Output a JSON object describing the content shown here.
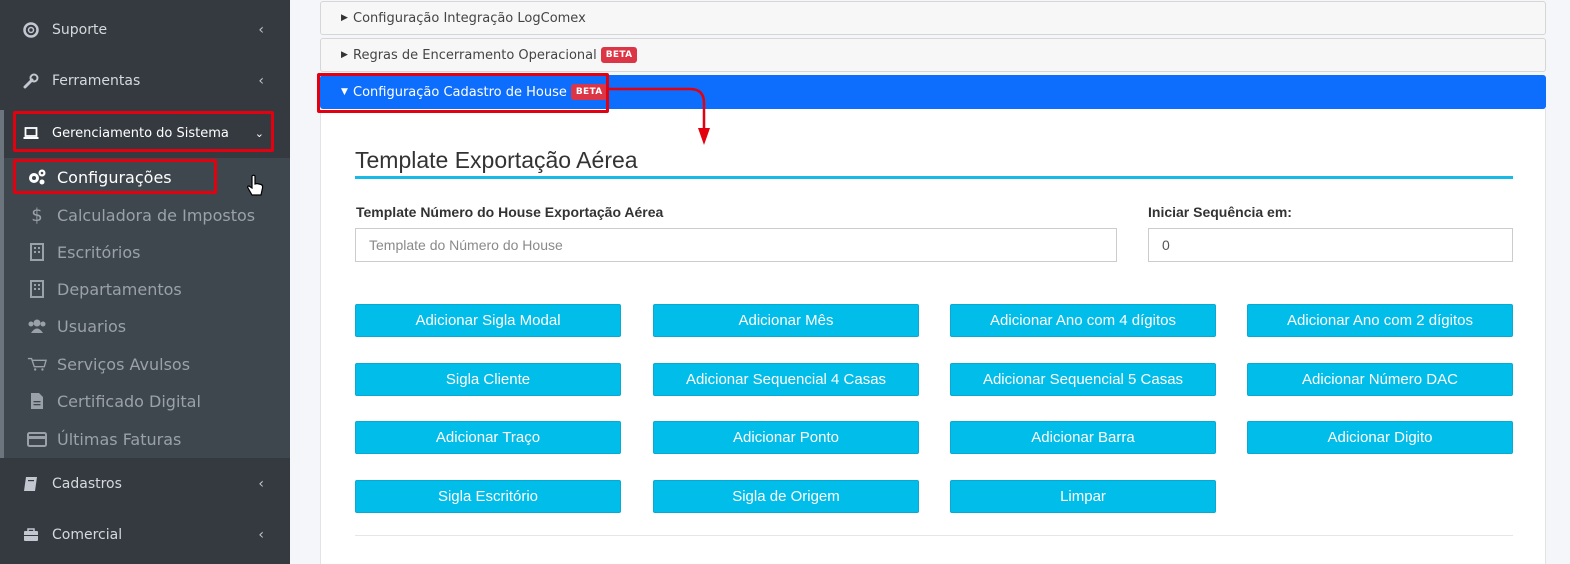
{
  "sidebar": {
    "top_items": [
      {
        "label": "Suporte",
        "icon": "life-ring-icon"
      },
      {
        "label": "Ferramentas",
        "icon": "wrench-icon"
      }
    ],
    "system_item": {
      "label": "Gerenciamento do Sistema",
      "icon": "laptop-icon"
    },
    "sub_items": [
      {
        "label": "Configurações",
        "icon": "cogs-icon"
      },
      {
        "label": "Calculadora de Impostos",
        "icon": "dollar-icon"
      },
      {
        "label": "Escritórios",
        "icon": "building-icon"
      },
      {
        "label": "Departamentos",
        "icon": "building-icon"
      },
      {
        "label": "Usuarios",
        "icon": "users-icon"
      },
      {
        "label": "Serviços Avulsos",
        "icon": "cart-icon"
      },
      {
        "label": "Certificado Digital",
        "icon": "file-icon"
      },
      {
        "label": "Últimas Faturas",
        "icon": "credit-card-icon"
      }
    ],
    "bottom_items": [
      {
        "label": "Cadastros",
        "icon": "book-icon"
      },
      {
        "label": "Comercial",
        "icon": "briefcase-icon"
      }
    ]
  },
  "accordion": [
    {
      "label": "Configuração Integração LogComex",
      "badge": ""
    },
    {
      "label": "Regras de Encerramento Operacional",
      "badge": "BETA"
    },
    {
      "label": "Configuração Cadastro de House",
      "badge": "BETA"
    }
  ],
  "form": {
    "section_title": "Template Exportação Aérea",
    "template_label": "Template Número do House Exportação Aérea",
    "template_placeholder": "Template do Número do House",
    "template_value": "",
    "sequence_label": "Iniciar Sequência em:",
    "sequence_value": "0"
  },
  "buttons": [
    "Adicionar Sigla Modal",
    "Adicionar Mês",
    "Adicionar Ano com 4 dígitos",
    "Adicionar Ano com 2 dígitos",
    "Sigla Cliente",
    "Adicionar Sequencial 4 Casas",
    "Adicionar Sequencial 5 Casas",
    "Adicionar Número DAC",
    "Adicionar Traço",
    "Adicionar Ponto",
    "Adicionar Barra",
    "Adicionar Digito",
    "Sigla Escritório",
    "Sigla de Origem",
    "Limpar"
  ],
  "colors": {
    "sidebar_bg": "#343a40",
    "accordion_active": "#0d6efd",
    "button_bg": "#00bde9",
    "highlight": "#e3000f",
    "badge": "#dc3545"
  }
}
